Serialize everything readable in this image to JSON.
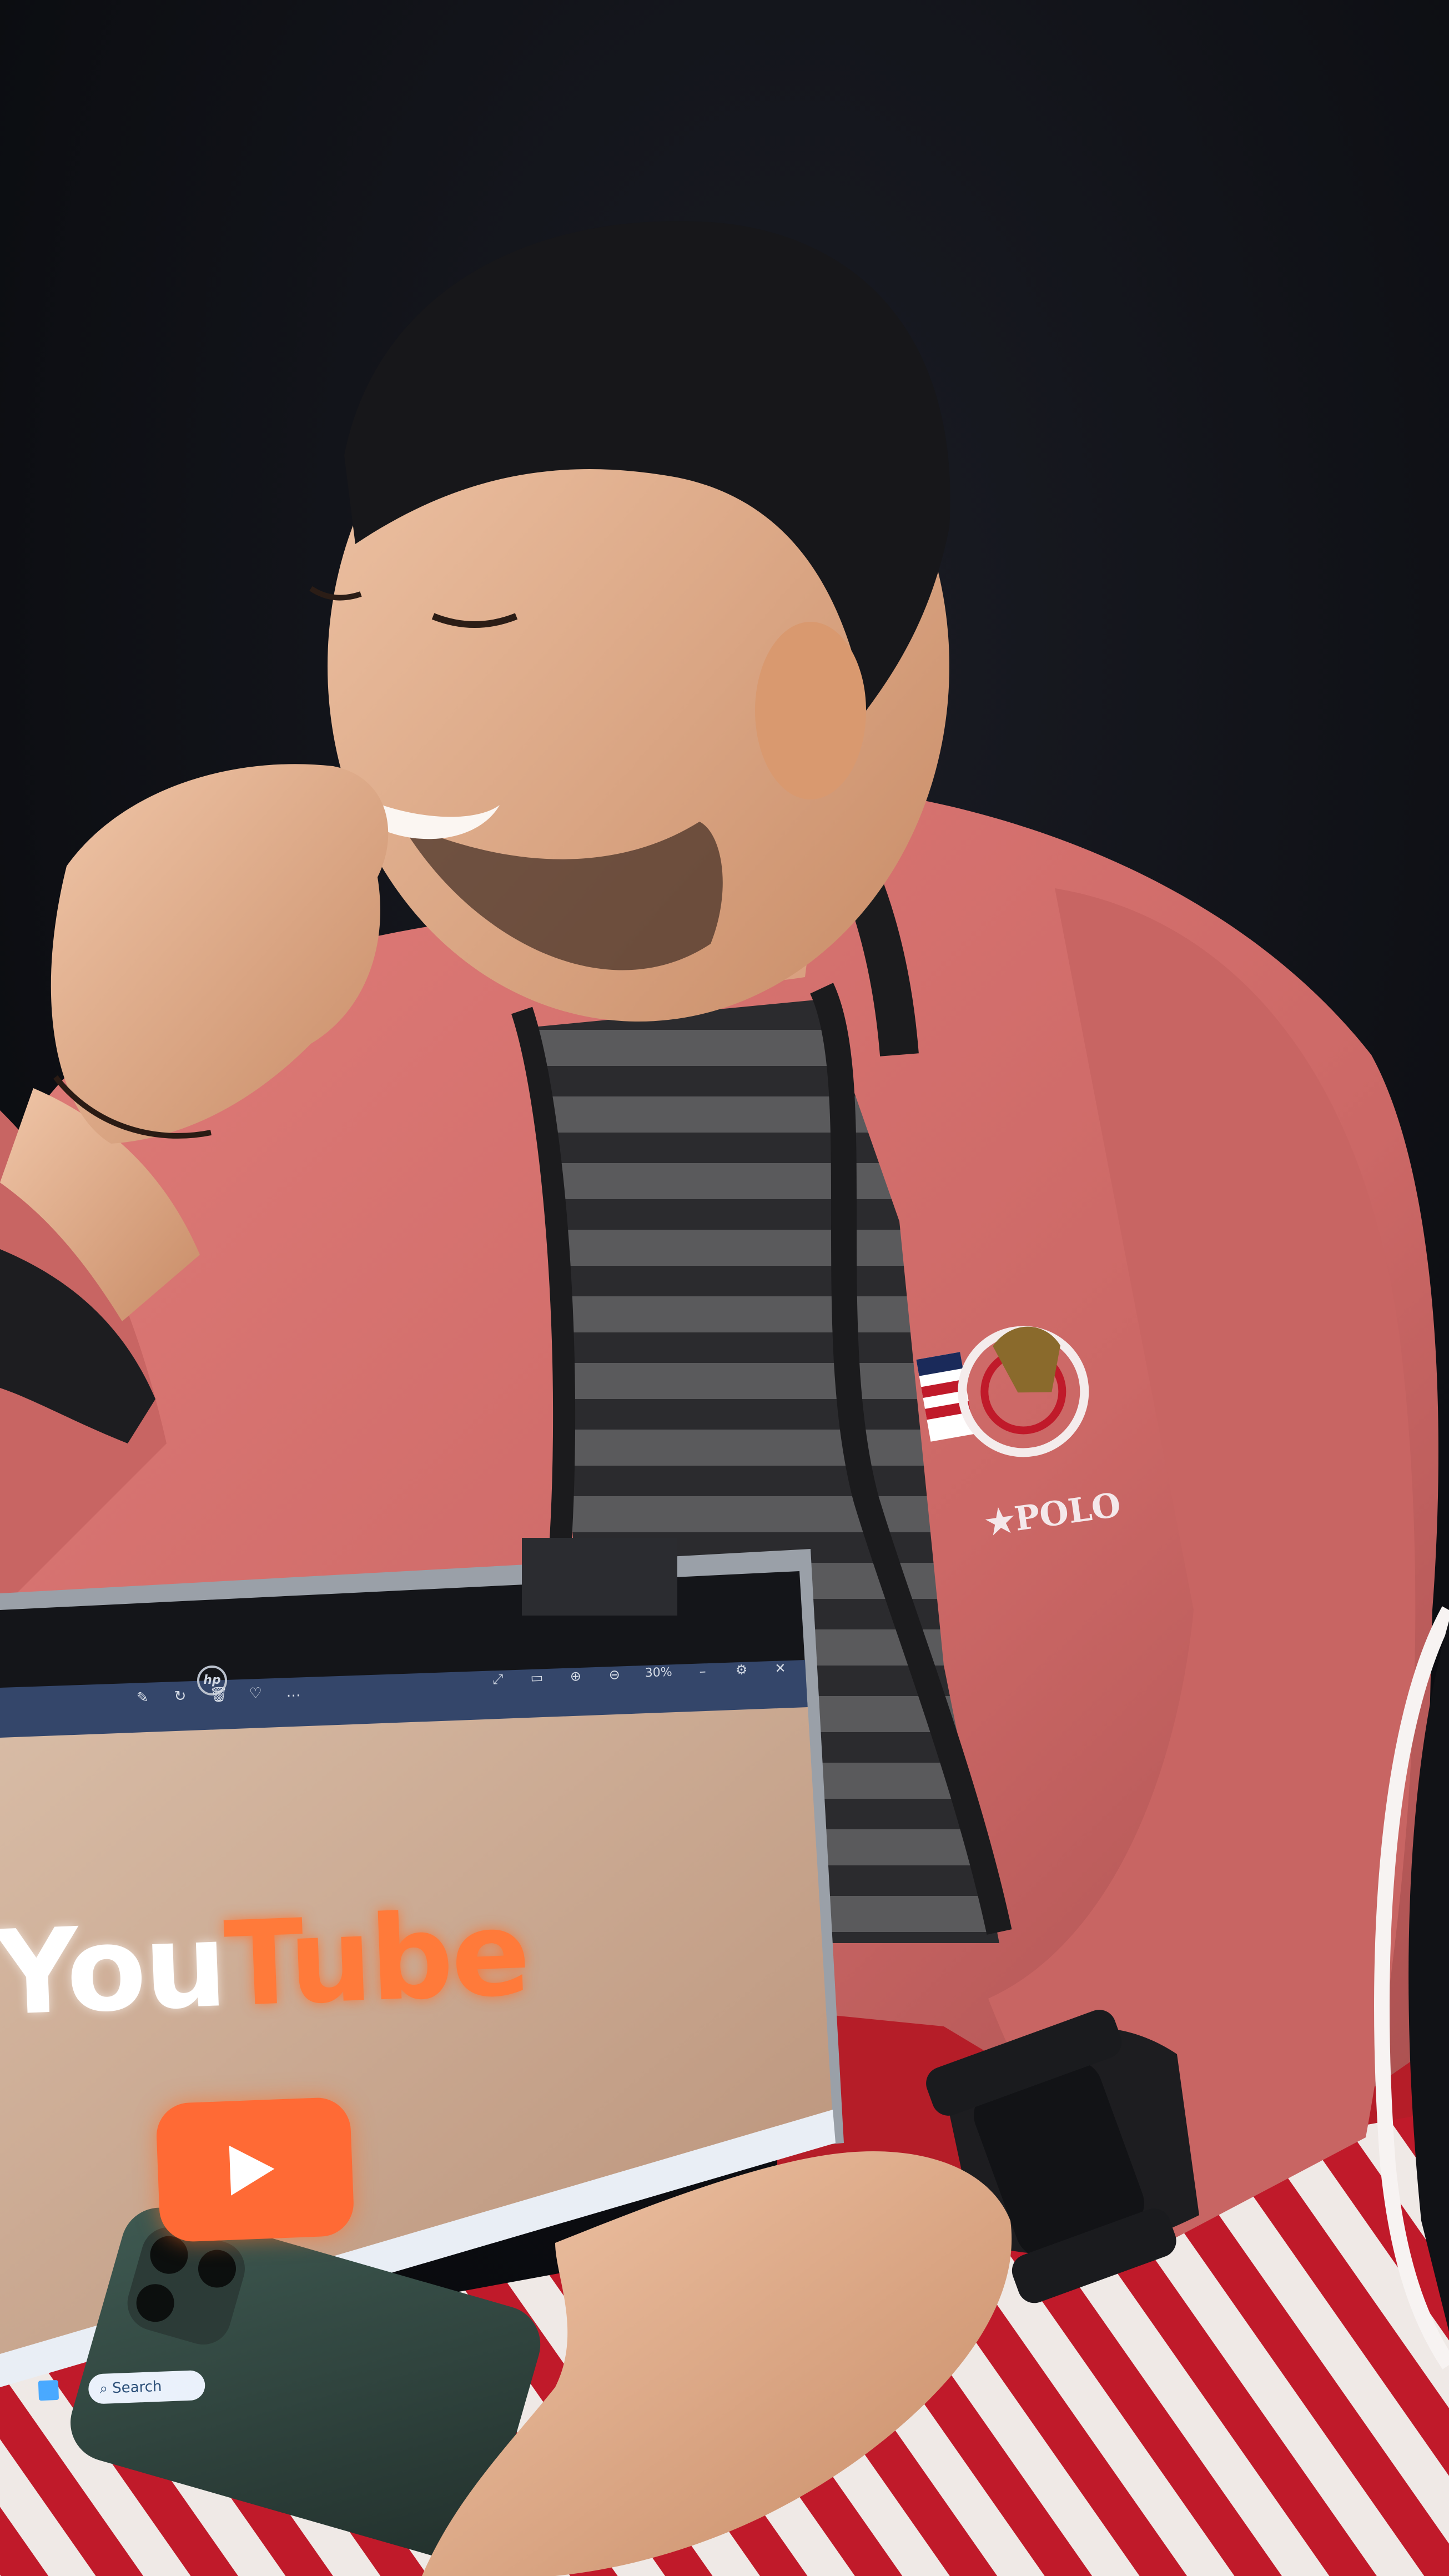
{
  "laptop": {
    "brand_logo": "hp",
    "toolbar": {
      "zoom_label": "30%",
      "icons": [
        "image-edit-icon",
        "rotate-icon",
        "delete-icon",
        "favorite-icon",
        "more-icon"
      ],
      "window_controls": [
        "expand-icon",
        "slideshow-icon",
        "zoom-in-icon",
        "zoom-out-icon",
        "minimize-icon",
        "settings-icon",
        "close-icon"
      ]
    },
    "screen_content": {
      "title_you": "You",
      "title_tube": "Tube"
    },
    "taskbar": {
      "search_placeholder": "Search"
    }
  },
  "jacket_badge": {
    "text": "★POLO"
  },
  "colors": {
    "background": "#0b0c10",
    "jacket": "#d2706f",
    "youtube_orange": "#ff6a35",
    "screen": "#c9a890",
    "stripe_red": "#c01a2a"
  }
}
